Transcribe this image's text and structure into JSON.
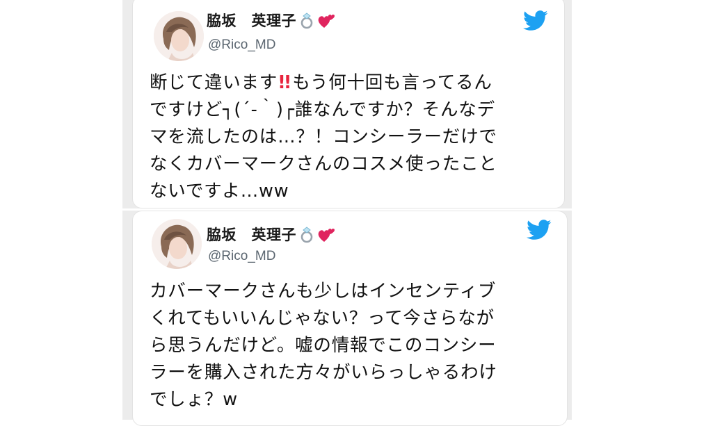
{
  "tweets": [
    {
      "author_name": "脇坂　英理子",
      "handle": "@Rico_MD",
      "emoji": [
        "ring-icon",
        "two-hearts-icon"
      ],
      "lines": [
        {
          "before": "断じて違います",
          "after": "もう何十回も言ってるん"
        },
        "ですけど┐(´-｀)┌誰なんですか？そんなデ",
        "マを流したのは…？！コンシーラーだけで",
        "なくカバーマークさんのコスメ使ったこと",
        "ないですよ…ww"
      ]
    },
    {
      "author_name": "脇坂　英理子",
      "handle": "@Rico_MD",
      "emoji": [
        "ring-icon",
        "two-hearts-icon"
      ],
      "lines": [
        "カバーマークさんも少しはインセンティブ",
        "くれてもいいんじゃない？って今さらなが",
        "ら思うんだけど。嘘の情報でこのコンシー",
        "ラーを購入された方々がいらっしゃるわけ",
        "でしょ？w"
      ]
    }
  ],
  "colors": {
    "twitter_blue": "#1da1f2",
    "exclamation_red": "#e8243d",
    "handle_gray": "#5b6670",
    "background_strip": "#ececec"
  }
}
